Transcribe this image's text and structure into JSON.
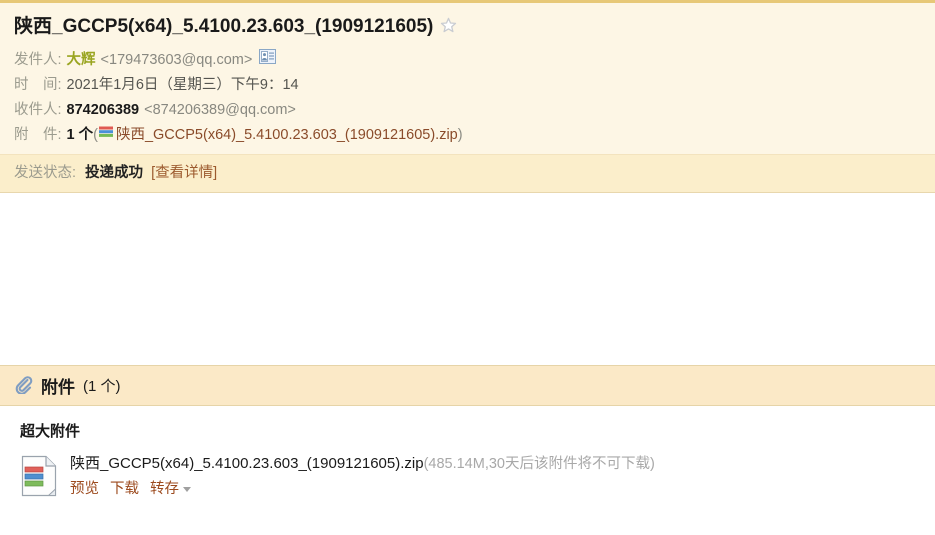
{
  "mail": {
    "subject": "陕西_GCCP5(x64)_5.4100.23.603_(1909121605)",
    "star_icon": "star-outline-icon",
    "from": {
      "label": "发件人:",
      "name": "大辉",
      "address": "<179473603@qq.com>",
      "contact_icon": "contact-card-icon"
    },
    "time": {
      "label": "时　间:",
      "value": "2021年1月6日（星期三）下午9：14"
    },
    "to": {
      "label": "收件人:",
      "name": "874206389",
      "address": "<874206389@qq.com>"
    },
    "attachment_line": {
      "label": "附　件:",
      "count": "1 个",
      "open_paren": "(",
      "zip_icon": "zip-file-icon",
      "name": "陕西_GCCP5(x64)_5.4100.23.603_(1909121605).zip",
      "close_paren": ")"
    },
    "send_status": {
      "label": "发送状态:",
      "value": "投递成功",
      "detail_link": "[查看详情]"
    }
  },
  "attachment_bar": {
    "clip_icon": "paperclip-icon",
    "title": "附件",
    "count": "(1 个)"
  },
  "attachment_panel": {
    "heading": "超大附件",
    "file": {
      "icon": "archive-file-icon",
      "name": "陕西_GCCP5(x64)_5.4100.23.603_(1909121605).zip",
      "meta": "(485.14M,30天后该附件将不可下载)",
      "actions": [
        {
          "label": "预览",
          "name": "preview-link"
        },
        {
          "label": "下载",
          "name": "download-link"
        },
        {
          "label": "转存",
          "name": "save-to-cloud-link"
        }
      ],
      "caret_icon": "caret-down-icon"
    }
  },
  "colors": {
    "header_bg": "#fdf6e5",
    "status_bg": "#fbeecb",
    "attach_bar_bg": "#fbe9c7",
    "top_border": "#e7c877",
    "link": "#9c4a1e",
    "sender_name": "#9aa521"
  }
}
